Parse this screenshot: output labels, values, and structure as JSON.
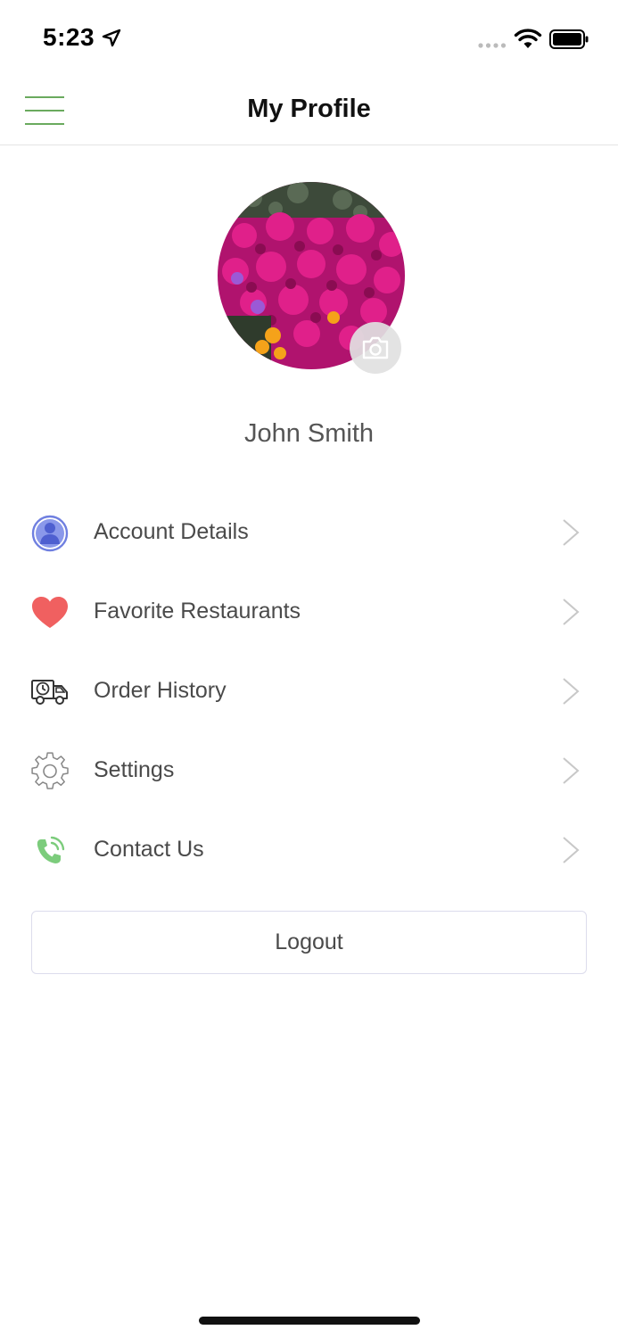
{
  "status_bar": {
    "time": "5:23"
  },
  "nav": {
    "title": "My Profile"
  },
  "profile": {
    "name": "John Smith"
  },
  "menu": {
    "items": [
      {
        "label": "Account Details",
        "icon": "user-circle-icon"
      },
      {
        "label": "Favorite Restaurants",
        "icon": "heart-icon"
      },
      {
        "label": "Order History",
        "icon": "delivery-truck-clock-icon"
      },
      {
        "label": "Settings",
        "icon": "gear-icon"
      },
      {
        "label": "Contact Us",
        "icon": "phone-call-icon"
      }
    ]
  },
  "logout": {
    "label": "Logout"
  },
  "colors": {
    "accent_green": "#6aaa5e",
    "user_icon_blue": "#6f7fe0",
    "heart_red": "#f06060",
    "phone_green": "#7ccc7c"
  }
}
